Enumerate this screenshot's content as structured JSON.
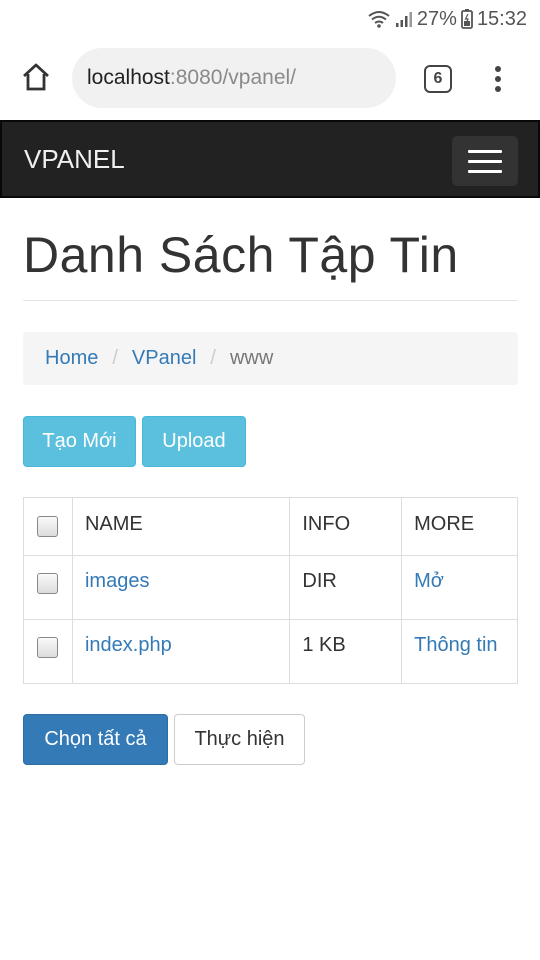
{
  "status_bar": {
    "battery": "27%",
    "time": "15:32",
    "icons": [
      "wifi-icon",
      "signal-icon",
      "battery-icon"
    ]
  },
  "browser": {
    "url_host": "localhost",
    "url_rest": ":8080/vpanel/",
    "tab_count": "6",
    "icons": [
      "home-icon",
      "tabs-icon",
      "more-vert-icon"
    ]
  },
  "navbar": {
    "brand": "VPANEL",
    "toggle_icon": "hamburger-icon"
  },
  "page": {
    "title": "Danh Sách Tập Tin"
  },
  "breadcrumb": {
    "items": [
      {
        "label": "Home"
      },
      {
        "label": "VPanel"
      },
      {
        "label": "www"
      }
    ]
  },
  "actions": {
    "create_label": "Tạo Mới",
    "upload_label": "Upload"
  },
  "table": {
    "headers": [
      "NAME",
      "INFO",
      "MORE"
    ],
    "rows": [
      {
        "name": "images",
        "info": "DIR",
        "more": "Mở"
      },
      {
        "name": "index.php",
        "info": "1 KB",
        "more": "Thông tin"
      }
    ]
  },
  "footer_actions": {
    "select_all_label": "Chọn tất cả",
    "execute_label": "Thực hiện"
  },
  "colors": {
    "primary": "#337ab7",
    "info": "#5bc0de",
    "navbar": "#222222"
  }
}
